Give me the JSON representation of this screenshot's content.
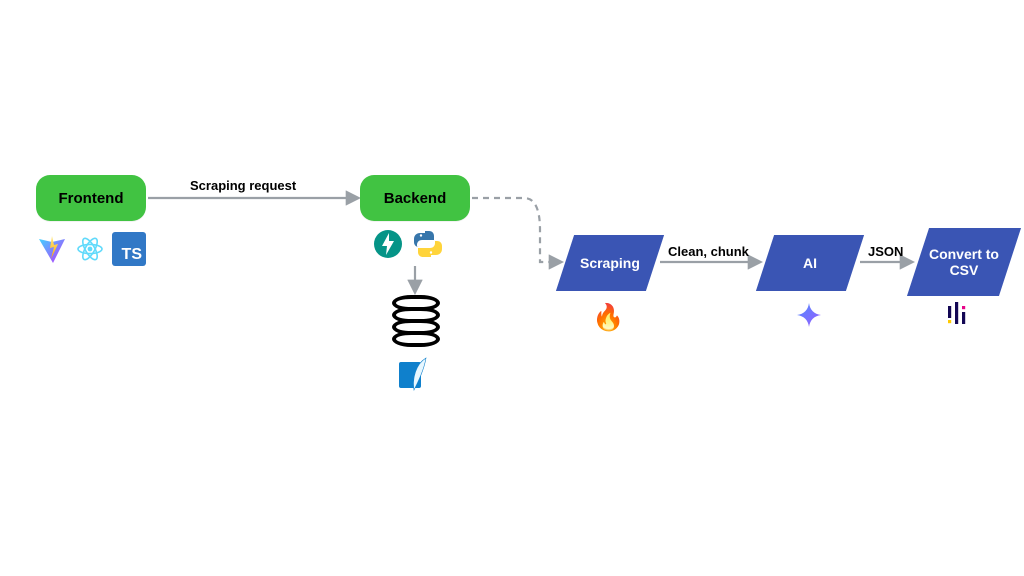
{
  "nodes": {
    "frontend": "Frontend",
    "backend": "Backend",
    "scraping": "Scraping",
    "ai": "AI",
    "csv": "Convert to CSV"
  },
  "edges": {
    "frontend_backend": "Scraping request",
    "scraping_ai": "Clean, chunk",
    "ai_csv": "JSON"
  },
  "icons": {
    "frontend": [
      "vite",
      "react",
      "typescript"
    ],
    "backend": [
      "fastapi",
      "python"
    ],
    "scraping_below": "fire",
    "ai_below": "gemini-sparkle",
    "csv_below": "pandas",
    "backend_db": "database",
    "backend_db_engine": "sqlite-feather"
  },
  "colors": {
    "pill_green": "#41c342",
    "para_blue": "#3a55b4",
    "arrow_gray": "#9aa0a6",
    "ts_blue": "#3178c6"
  }
}
